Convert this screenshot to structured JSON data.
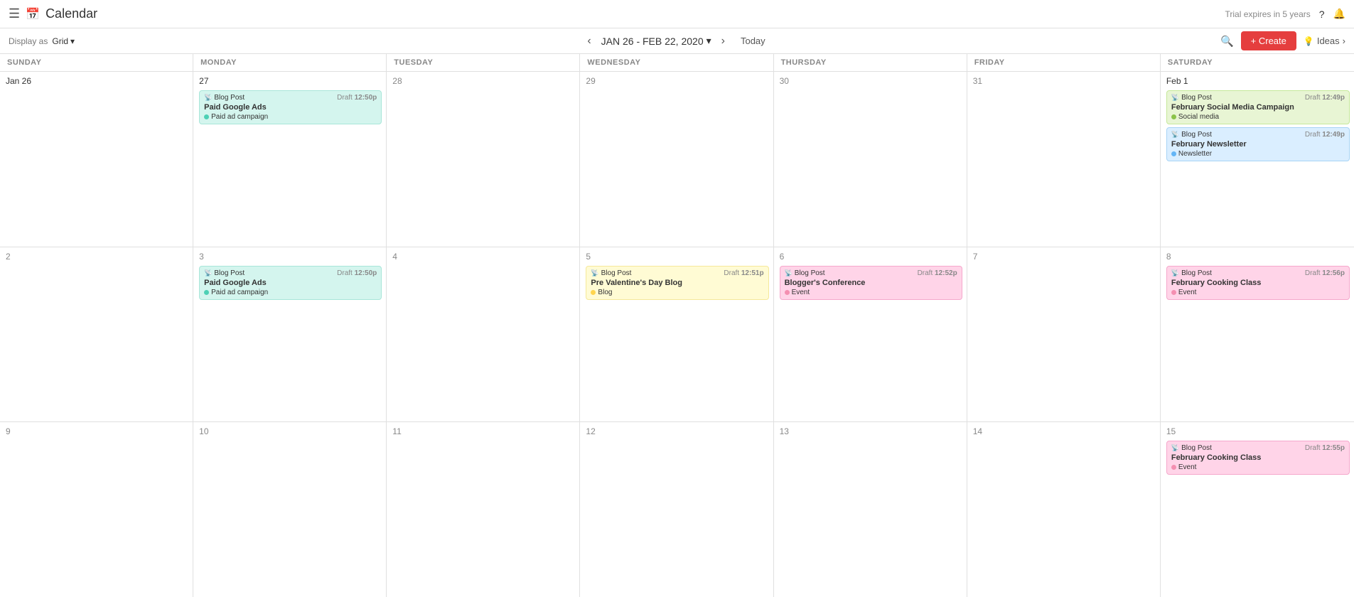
{
  "app": {
    "title": "Calendar",
    "icon": "📅",
    "trial_text": "Trial expires in 5 years"
  },
  "toolbar": {
    "display_as_label": "Display as",
    "grid_label": "Grid",
    "date_range": "JAN 26 - FEB 22, 2020",
    "today_label": "Today",
    "create_label": "+ Create",
    "ideas_label": "Ideas",
    "search_icon": "🔍",
    "help_icon": "?",
    "bell_icon": "🔔",
    "lightbulb_icon": "💡",
    "chevron_down": "▾",
    "chevron_left": "‹",
    "chevron_right": "›"
  },
  "day_headers": [
    "SUNDAY",
    "MONDAY",
    "TUESDAY",
    "WEDNESDAY",
    "THURSDAY",
    "FRIDAY",
    "SATURDAY"
  ],
  "weeks": [
    {
      "days": [
        {
          "number": "Jan 26",
          "number_style": "dark",
          "events": []
        },
        {
          "number": "27",
          "number_style": "dark",
          "events": [
            {
              "type": "Blog Post",
              "status": "Draft",
              "time": "12:50p",
              "title": "Paid Google Ads",
              "tag": "Paid ad campaign",
              "tag_dot": "dot-teal",
              "color": "card-teal"
            }
          ]
        },
        {
          "number": "28",
          "events": []
        },
        {
          "number": "29",
          "events": []
        },
        {
          "number": "30",
          "events": []
        },
        {
          "number": "31",
          "events": []
        },
        {
          "number": "Feb 1",
          "number_style": "dark",
          "events": [
            {
              "type": "Blog Post",
              "status": "Draft",
              "time": "12:49p",
              "title": "February Social Media Campaign",
              "tag": "Social media",
              "tag_dot": "dot-green",
              "color": "card-green"
            },
            {
              "type": "Blog Post",
              "status": "Draft",
              "time": "12:49p",
              "title": "February Newsletter",
              "tag": "Newsletter",
              "tag_dot": "dot-blue",
              "color": "card-blue"
            }
          ]
        }
      ]
    },
    {
      "days": [
        {
          "number": "2",
          "events": []
        },
        {
          "number": "3",
          "events": [
            {
              "type": "Blog Post",
              "status": "Draft",
              "time": "12:50p",
              "title": "Paid Google Ads",
              "tag": "Paid ad campaign",
              "tag_dot": "dot-teal",
              "color": "card-teal"
            }
          ]
        },
        {
          "number": "4",
          "events": []
        },
        {
          "number": "5",
          "events": [
            {
              "type": "Blog Post",
              "status": "Draft",
              "time": "12:51p",
              "title": "Pre Valentine's Day Blog",
              "tag": "Blog",
              "tag_dot": "dot-yellow",
              "color": "card-yellow"
            }
          ]
        },
        {
          "number": "6",
          "events": [
            {
              "type": "Blog Post",
              "status": "Draft",
              "time": "12:52p",
              "title": "Blogger's Conference",
              "tag": "Event",
              "tag_dot": "dot-pink",
              "color": "card-pink"
            }
          ]
        },
        {
          "number": "7",
          "events": []
        },
        {
          "number": "8",
          "events": [
            {
              "type": "Blog Post",
              "status": "Draft",
              "time": "12:56p",
              "title": "February Cooking Class",
              "tag": "Event",
              "tag_dot": "dot-pink",
              "color": "card-pink"
            }
          ]
        }
      ]
    },
    {
      "days": [
        {
          "number": "9",
          "events": []
        },
        {
          "number": "10",
          "events": []
        },
        {
          "number": "11",
          "events": []
        },
        {
          "number": "12",
          "events": []
        },
        {
          "number": "13",
          "events": []
        },
        {
          "number": "14",
          "events": []
        },
        {
          "number": "15",
          "events": [
            {
              "type": "Blog Post",
              "status": "Draft",
              "time": "12:55p",
              "title": "February Cooking Class",
              "tag": "Event",
              "tag_dot": "dot-pink",
              "color": "card-pink"
            }
          ]
        }
      ]
    }
  ]
}
